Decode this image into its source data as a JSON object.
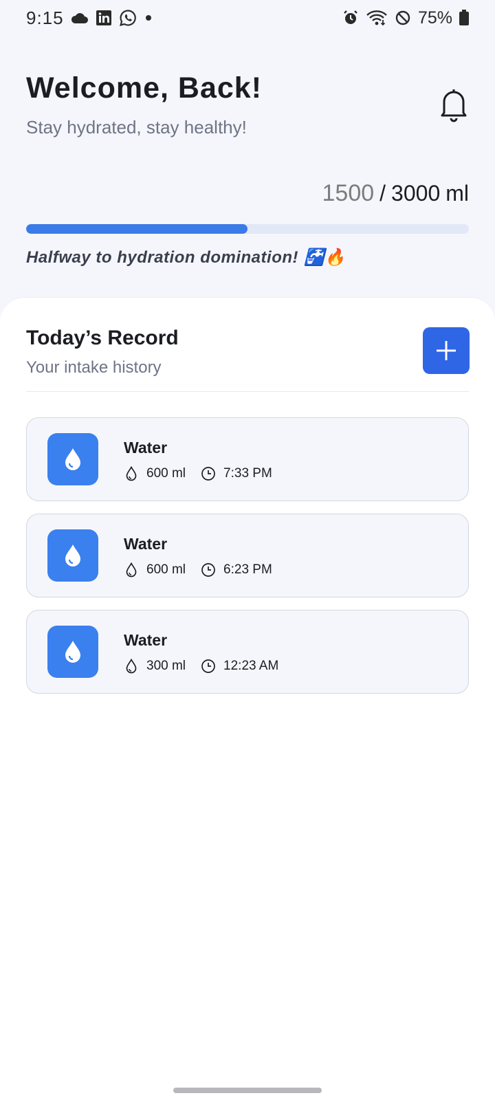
{
  "status_bar": {
    "time": "9:15",
    "battery": "75%",
    "icons_left": [
      "cloud-icon",
      "linkedin-icon",
      "whatsapp-icon",
      "dot-icon"
    ],
    "icons_right": [
      "alarm-icon",
      "wifi-icon",
      "do-not-disturb-icon",
      "battery-icon"
    ]
  },
  "header": {
    "title": "Welcome, Back!",
    "subtitle": "Stay hydrated, stay healthy!"
  },
  "progress": {
    "current": "1500",
    "separator": "/",
    "goal": "3000",
    "unit": "ml",
    "fraction": 0.5,
    "message": "Halfway to hydration domination!",
    "emoji": "🚰🔥"
  },
  "record": {
    "title": "Today’s Record",
    "subtitle": "Your intake history",
    "entries": [
      {
        "name": "Water",
        "amount": "600 ml",
        "time": "7:33 PM"
      },
      {
        "name": "Water",
        "amount": "600 ml",
        "time": "6:23 PM"
      },
      {
        "name": "Water",
        "amount": "300 ml",
        "time": "12:23 AM"
      }
    ]
  },
  "colors": {
    "accent": "#2f66e6",
    "progress": "#3b7be8",
    "track": "#e2e8f8",
    "card_icon": "#3a80ee"
  }
}
